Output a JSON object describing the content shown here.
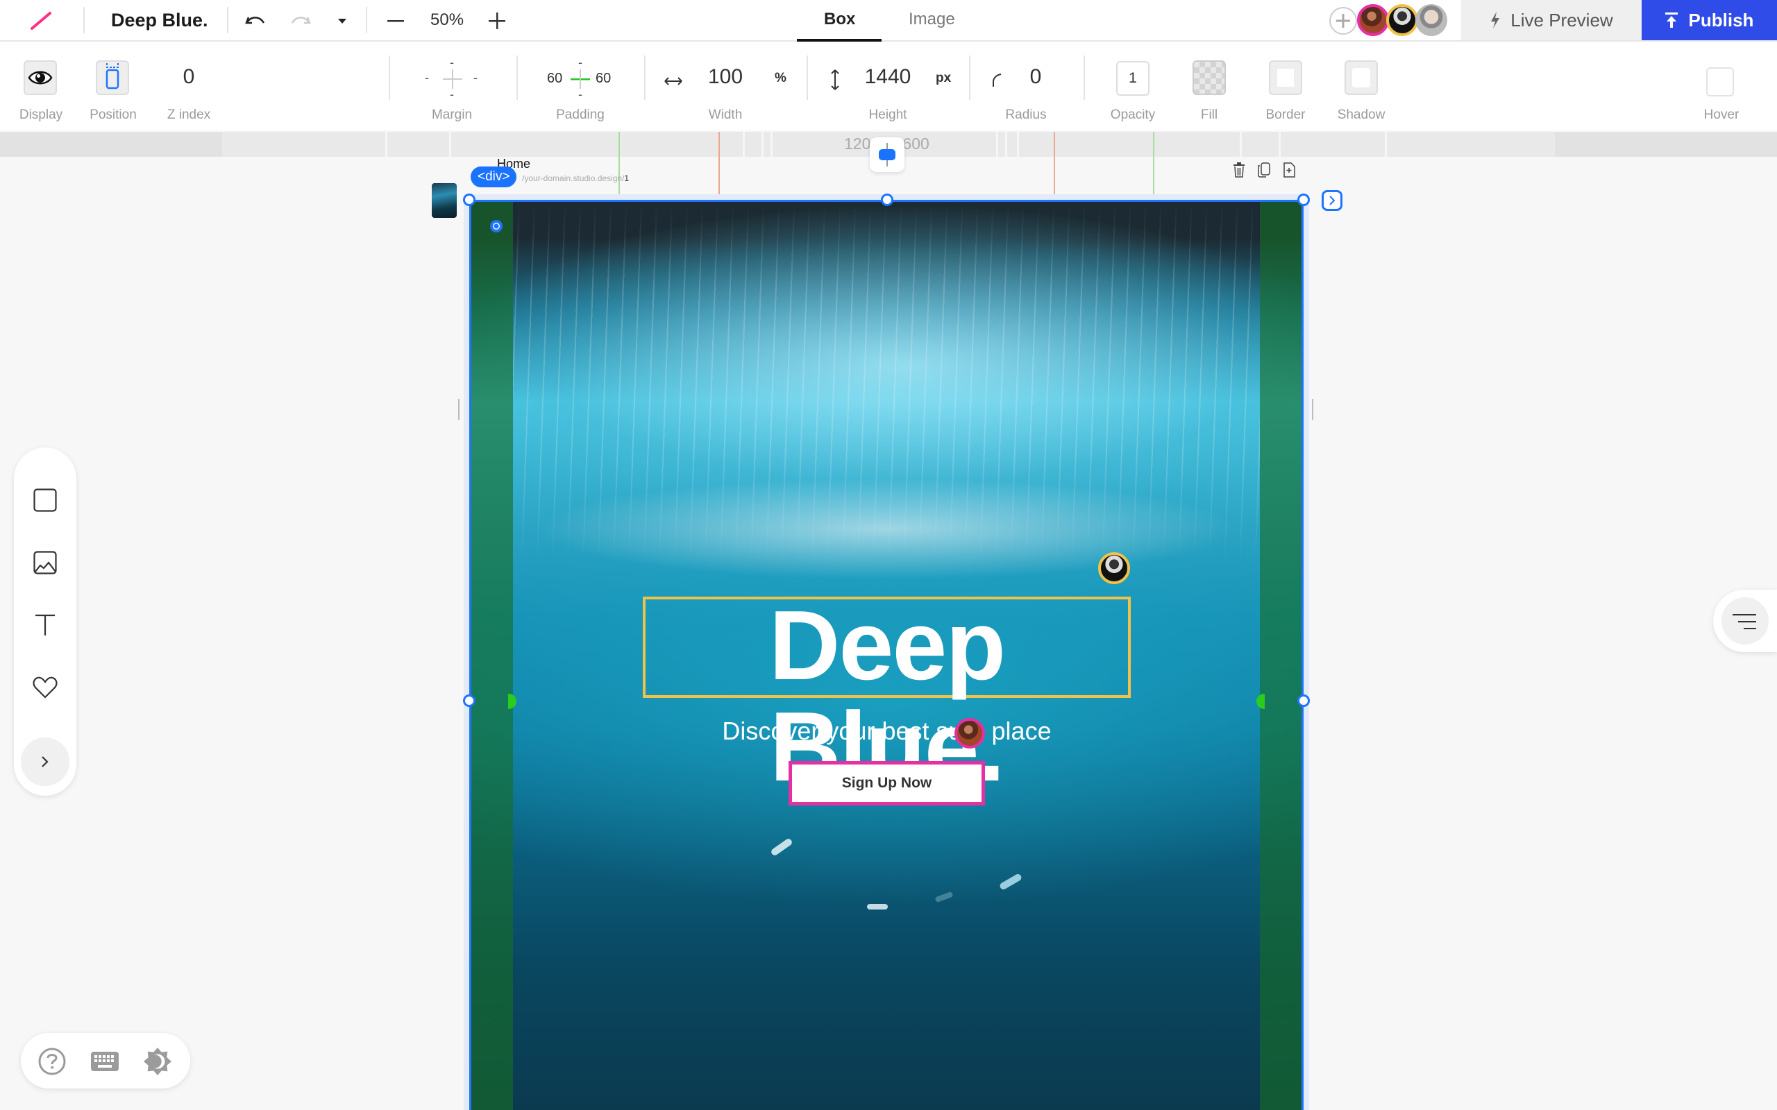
{
  "app": {
    "document_title": "Deep Blue.",
    "zoom_level": "50%",
    "tabs": [
      {
        "label": "Box",
        "active": true
      },
      {
        "label": "Image",
        "active": false
      }
    ],
    "live_preview_label": "Live Preview",
    "publish_label": "Publish",
    "collaborators": [
      {
        "name": "collaborator-1",
        "ring_color": "#e62ea5"
      },
      {
        "name": "collaborator-2",
        "ring_color": "#f0c24a"
      },
      {
        "name": "collaborator-3",
        "ring_color": null
      }
    ],
    "accent_color": "#2f4ce8",
    "selection_color": "#1f74ff"
  },
  "properties": {
    "display": {
      "label": "Display",
      "icon": "eye-icon"
    },
    "position": {
      "label": "Position",
      "icon": "position-icon"
    },
    "z_index": {
      "label": "Z index",
      "value": "0"
    },
    "margin": {
      "label": "Margin",
      "top": "-",
      "right": "-",
      "bottom": "-",
      "left": "-"
    },
    "padding": {
      "label": "Padding",
      "top": "-",
      "right": "60",
      "bottom": "-",
      "left": "60"
    },
    "width": {
      "label": "Width",
      "value": "100",
      "unit": "%"
    },
    "height": {
      "label": "Height",
      "value": "1440",
      "unit": "px"
    },
    "radius": {
      "label": "Radius",
      "value": "0"
    },
    "opacity": {
      "label": "Opacity",
      "value": "1"
    },
    "fill": {
      "label": "Fill"
    },
    "border": {
      "label": "Border"
    },
    "shadow": {
      "label": "Shadow"
    },
    "hover": {
      "label": "Hover"
    }
  },
  "ruler": {
    "breakpoint_text": "1200 - 1600"
  },
  "canvas": {
    "page_name": "Home",
    "page_url_prefix": "/your-domain.studio.design/",
    "page_url_suffix": "1",
    "selected_element_tag": "<div>",
    "hero": {
      "title": "Deep Blue.",
      "subtitle": "Discover your best surf place",
      "subtitle_visible_left": "Discover your best su",
      "subtitle_visible_right": "place",
      "cta_label": "Sign Up Now"
    }
  },
  "left_toolbar": [
    {
      "name": "box-tool",
      "icon": "square-icon"
    },
    {
      "name": "image-tool",
      "icon": "image-icon"
    },
    {
      "name": "text-tool",
      "icon": "text-icon"
    },
    {
      "name": "icon-tool",
      "icon": "heart-icon"
    },
    {
      "name": "expand-tool",
      "icon": "chevron-right-icon"
    }
  ],
  "bottom_toolbar": [
    {
      "name": "help",
      "icon": "help-icon"
    },
    {
      "name": "keyboard-shortcuts",
      "icon": "keyboard-icon"
    },
    {
      "name": "theme-toggle",
      "icon": "theme-icon"
    }
  ]
}
